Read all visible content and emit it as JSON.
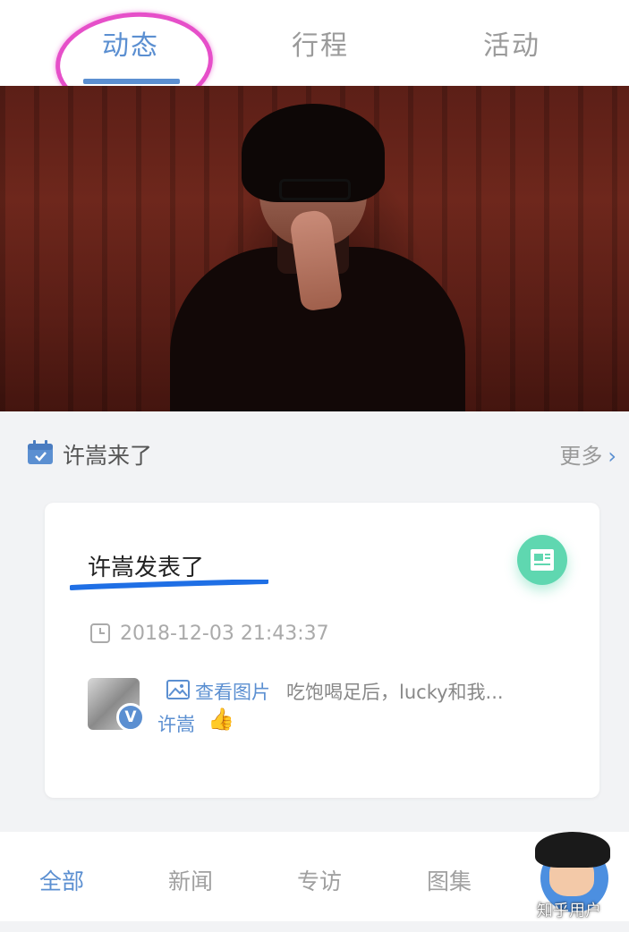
{
  "top_tabs": [
    {
      "label": "动态",
      "active": true
    },
    {
      "label": "行程",
      "active": false
    },
    {
      "label": "活动",
      "active": false
    }
  ],
  "section": {
    "title": "许嵩来了",
    "more_label": "更多",
    "more_chevron": "›"
  },
  "card": {
    "title": "许嵩发表了",
    "time": "2018-12-03 21:43:37",
    "view_pics": "查看图片",
    "post_text": "吃饱喝足后，lucky和我...",
    "author": "许嵩",
    "verified_mark": "V",
    "thumb": "👍"
  },
  "bottom_tabs": [
    {
      "label": "全部",
      "active": true
    },
    {
      "label": "新闻",
      "active": false
    },
    {
      "label": "专访",
      "active": false
    },
    {
      "label": "图集",
      "active": false
    }
  ],
  "watermark": "知乎用户",
  "colors": {
    "accent": "#5b8fd1",
    "highlight_circle": "#e64fc9",
    "doc_badge": "#5fd7b0"
  },
  "icons": {
    "section": "calendar-icon",
    "time": "clock-icon",
    "pics": "image-icon",
    "badge": "document-icon"
  }
}
